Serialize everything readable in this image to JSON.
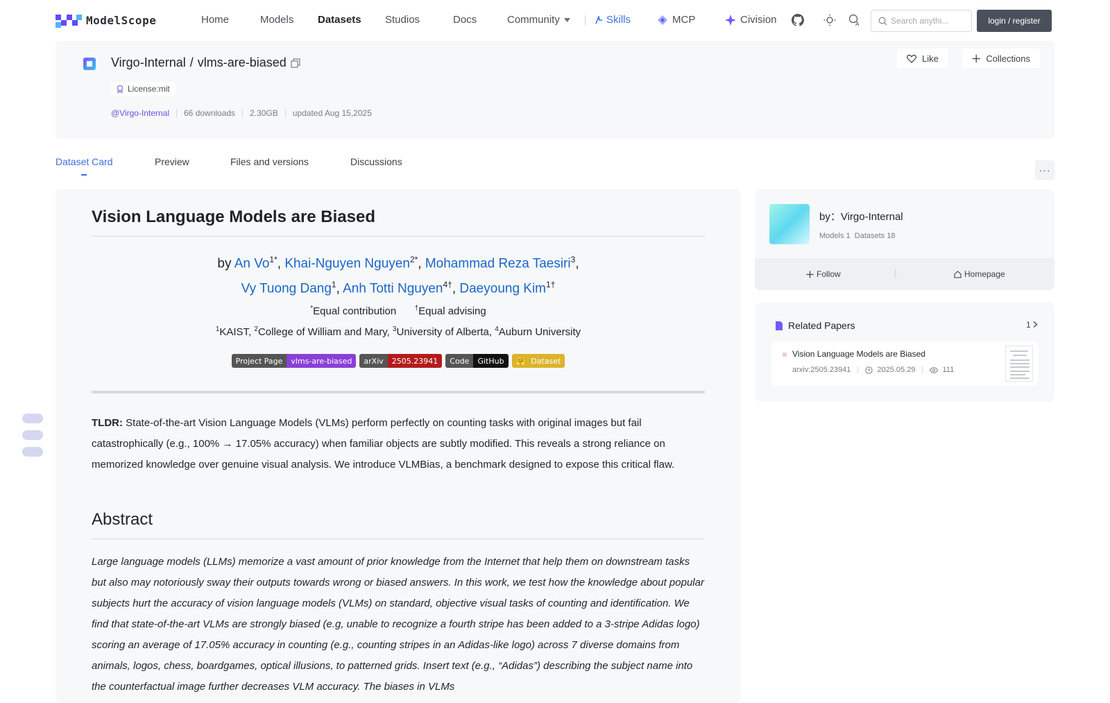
{
  "brand": {
    "name": "ModelScope"
  },
  "nav": {
    "home": "Home",
    "models": "Models",
    "datasets": "Datasets",
    "studios": "Studios",
    "docs": "Docs",
    "community": "Community",
    "skills": "Skills",
    "mcp": "MCP",
    "civision": "Civision"
  },
  "search": {
    "placeholder": "Search anythi..."
  },
  "auth": {
    "login_label": "login / register"
  },
  "repo": {
    "owner": "Virgo-Internal",
    "separator": "/",
    "name": "vlms-are-biased",
    "license": "License:mit",
    "owner_handle": "@Virgo-Internal",
    "downloads": "66 downloads",
    "size": "2.30GB",
    "updated": "updated Aug 15,2025",
    "like_label": "Like",
    "collections_label": "Collections"
  },
  "tabs": {
    "card": "Dataset Card",
    "preview": "Preview",
    "files": "Files and versions",
    "discussions": "Discussions",
    "more": "···"
  },
  "card": {
    "title": "Vision Language Models are Biased",
    "by": "by ",
    "authors": [
      {
        "name": "An Vo",
        "sup": "1*",
        "after": ", "
      },
      {
        "name": "Khai-Nguyen Nguyen",
        "sup": "2*",
        "after": ", "
      },
      {
        "name": "Mohammad Reza Taesiri",
        "sup": "3",
        "after": ","
      },
      {
        "name": "Vy Tuong Dang",
        "sup": "1",
        "after": ", "
      },
      {
        "name": "Anh Totti Nguyen",
        "sup": "4†",
        "after": ", "
      },
      {
        "name": "Daeyoung Kim",
        "sup": "1†",
        "after": ""
      }
    ],
    "equal_contribution_mark": "*",
    "equal_contribution": "Equal contribution",
    "equal_advising_mark": "†",
    "equal_advising": "Equal advising",
    "affiliations": [
      {
        "sup": "1",
        "text": "KAIST, "
      },
      {
        "sup": "2",
        "text": "College of William and Mary, "
      },
      {
        "sup": "3",
        "text": "University of Alberta, "
      },
      {
        "sup": "4",
        "text": "Auburn University"
      }
    ],
    "badges": [
      {
        "left": "Project Page",
        "right": "vlms-are-biased",
        "color": "#8a3fd6"
      },
      {
        "left": "arXiv",
        "right": "2505.23941",
        "color": "#b31b1b"
      },
      {
        "left": "Code",
        "right": "GitHub",
        "color": "#111111"
      },
      {
        "left": "🤗",
        "right": "Dataset",
        "color": "#dbb42c"
      }
    ],
    "tldr_label": "TLDR:",
    "tldr_text": " State-of-the-art Vision Language Models (VLMs) perform perfectly on counting tasks with original images but fail catastrophically (e.g., 100% → 17.05% accuracy) when familiar objects are subtly modified. This reveals a strong reliance on memorized knowledge over genuine visual analysis. We introduce VLMBias, a benchmark designed to expose this critical flaw.",
    "abstract_heading": "Abstract",
    "abstract_text": "Large language models (LLMs) memorize a vast amount of prior knowledge from the Internet that help them on downstream tasks but also may notoriously sway their outputs towards wrong or biased answers. In this work, we test how the knowledge about popular subjects hurt the accuracy of vision language models (VLMs) on standard, objective visual tasks of counting and identification. We find that state-of-the-art VLMs are strongly biased (e.g, unable to recognize a fourth stripe has been added to a 3-stripe Adidas logo) scoring an average of 17.05% accuracy in counting (e.g., counting stripes in an Adidas-like logo) across 7 diverse domains from animals, logos, chess, boardgames, optical illusions, to patterned grids. Insert text (e.g., “Adidas”) describing the subject name into the counterfactual image further decreases VLM accuracy. The biases in VLMs"
  },
  "owner_card": {
    "by": "by：Virgo-Internal",
    "models": "Models 1",
    "datasets": "Datasets 18",
    "follow": "Follow",
    "homepage": "Homepage"
  },
  "papers": {
    "title": "Related Papers",
    "count": "1",
    "items": [
      {
        "title": "Vision Language Models are Biased",
        "arxiv": "arxiv:2505.23941",
        "date": "2025.05.29",
        "views": "111"
      }
    ]
  },
  "colors": {
    "accent": "#624aff",
    "link": "#1a66c9",
    "tab_active": "#3b6fde"
  }
}
